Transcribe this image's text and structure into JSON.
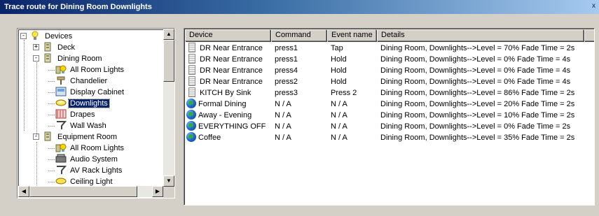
{
  "window": {
    "title": "Trace route for Dining Room Downlights",
    "close_glyph": "x"
  },
  "tree": {
    "items": [
      {
        "label": "Devices",
        "icon": "bulb-icon",
        "level": 0,
        "expander": "minus"
      },
      {
        "label": "Deck",
        "icon": "keypad-icon",
        "level": 1,
        "expander": "plus"
      },
      {
        "label": "Dining Room",
        "icon": "keypad-icon",
        "level": 1,
        "expander": "minus"
      },
      {
        "label": "All Room Lights",
        "icon": "room-lights-icon",
        "level": 2
      },
      {
        "label": "Chandelier",
        "icon": "chandelier-icon",
        "level": 2
      },
      {
        "label": "Display Cabinet",
        "icon": "cabinet-icon",
        "level": 2
      },
      {
        "label": "Downlights",
        "icon": "downlight-icon",
        "level": 2,
        "selected": true
      },
      {
        "label": "Drapes",
        "icon": "drapes-icon",
        "level": 2
      },
      {
        "label": "Wall Wash",
        "icon": "wallwash-icon",
        "level": 2
      },
      {
        "label": "Equipment Room",
        "icon": "keypad-icon",
        "level": 1,
        "expander": "minus"
      },
      {
        "label": "All Room Lights",
        "icon": "room-lights-icon",
        "level": 2
      },
      {
        "label": "Audio System",
        "icon": "audio-icon",
        "level": 2
      },
      {
        "label": "AV Rack Lights",
        "icon": "wallwash-icon",
        "level": 2
      },
      {
        "label": "Ceiling Light",
        "icon": "ceiling-light-icon",
        "level": 2
      }
    ]
  },
  "list": {
    "columns": [
      "Device",
      "Command",
      "Event name",
      "Details"
    ],
    "rows": [
      {
        "icon": "keypad-icon",
        "device": "DR Near Entrance",
        "command": "press1",
        "event": "Tap",
        "details": "Dining Room, Downlights-->Level = 70% Fade Time = 2s"
      },
      {
        "icon": "keypad-icon",
        "device": "DR Near Entrance",
        "command": "press1",
        "event": "Hold",
        "details": "Dining Room, Downlights-->Level = 0% Fade Time = 4s"
      },
      {
        "icon": "keypad-icon",
        "device": "DR Near Entrance",
        "command": "press4",
        "event": "Hold",
        "details": "Dining Room, Downlights-->Level = 0% Fade Time = 4s"
      },
      {
        "icon": "keypad-icon",
        "device": "DR Near Entrance",
        "command": "press2",
        "event": "Hold",
        "details": "Dining Room, Downlights-->Level = 0% Fade Time = 4s"
      },
      {
        "icon": "keypad-icon",
        "device": "KITCH By Sink",
        "command": "press3",
        "event": "Press 2",
        "details": "Dining Room, Downlights-->Level = 86% Fade Time = 2s"
      },
      {
        "icon": "globe-icon",
        "device": "Formal Dining",
        "command": "N / A",
        "event": "N / A",
        "details": "Dining Room, Downlights-->Level = 20% Fade Time = 2s"
      },
      {
        "icon": "globe-icon",
        "device": "Away - Evening",
        "command": "N / A",
        "event": "N / A",
        "details": "Dining Room, Downlights-->Level = 10% Fade Time = 2s"
      },
      {
        "icon": "globe-icon",
        "device": "EVERYTHING OFF",
        "command": "N / A",
        "event": "N / A",
        "details": "Dining Room, Downlights-->Level = 0% Fade Time = 2s"
      },
      {
        "icon": "globe-icon",
        "device": "Coffee",
        "command": "N / A",
        "event": "N / A",
        "details": "Dining Room, Downlights-->Level = 35% Fade Time = 2s"
      }
    ]
  }
}
